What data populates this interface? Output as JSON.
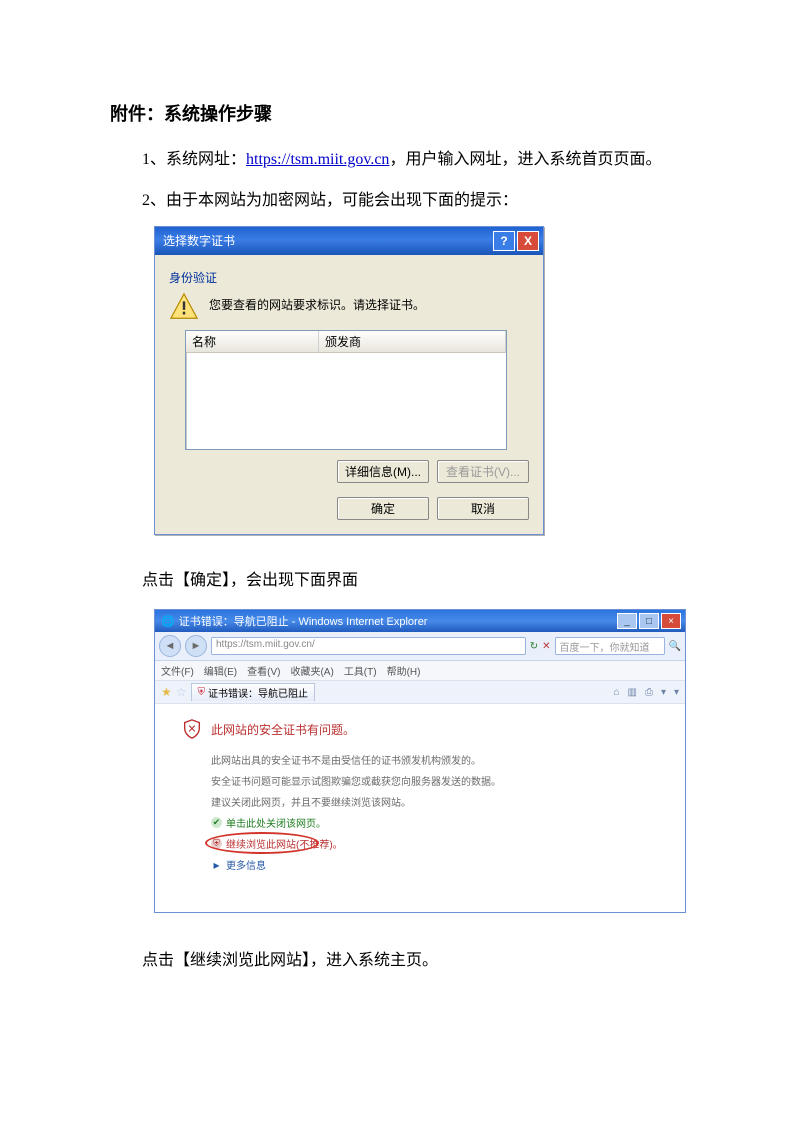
{
  "title": "附件：系统操作步骤",
  "p1_a": "1、系统网址：",
  "p1_url": "https://tsm.miit.gov.cn",
  "p1_b": "，用户输入网址，进入系统首页页面。",
  "p2": "2、由于本网站为加密网站，可能会出现下面的提示：",
  "dialog": {
    "title": "选择数字证书",
    "help": "?",
    "close": "X",
    "auth": "身份验证",
    "message": "您要查看的网站要求标识。请选择证书。",
    "col1": "名称",
    "col2": "颁发商",
    "details": "详细信息(M)...",
    "viewcert": "查看证书(V)...",
    "ok": "确定",
    "cancel": "取消"
  },
  "p3": "点击【确定】，会出现下面界面",
  "ie": {
    "title": "证书错误：导航已阻止 - Windows Internet Explorer",
    "url": "https://tsm.miit.gov.cn/",
    "search_placeholder": "百度一下，你就知道",
    "menu": [
      "文件(F)",
      "编辑(E)",
      "查看(V)",
      "收藏夹(A)",
      "工具(T)",
      "帮助(H)"
    ],
    "tab": "证书错误：导航已阻止",
    "heading": "此网站的安全证书有问题。",
    "line1": "此网站出具的安全证书不是由受信任的证书颁发机构颁发的。",
    "line2": "安全证书问题可能显示试图欺骗您或截获您向服务器发送的数据。",
    "line3": "建议关闭此网页，并且不要继续浏览该网站。",
    "opt1": "单击此处关闭该网页。",
    "opt2": "继续浏览此网站(不推荐)。",
    "opt3": "更多信息"
  },
  "p4": "点击【继续浏览此网站】，进入系统主页。"
}
